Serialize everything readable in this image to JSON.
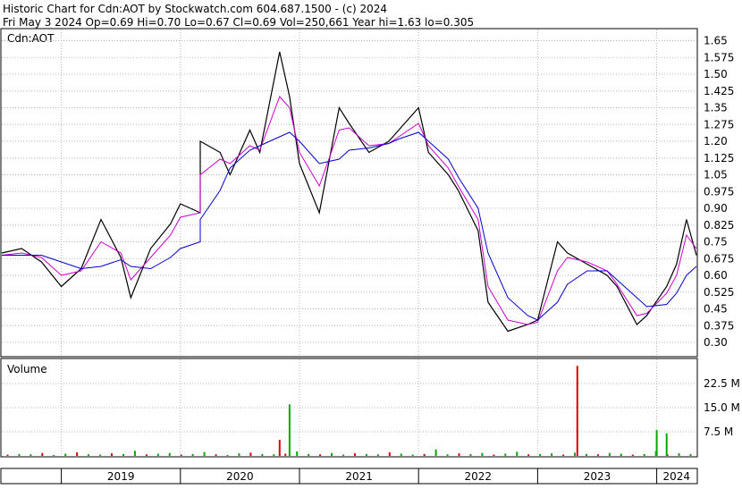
{
  "header": {
    "line1": "Historic Chart for Cdn:AOT by Stockwatch.com 604.687.1500 - (c) 2024",
    "line2": "Fri May  3 2024  Op=0.69  Hi=0.70  Lo=0.67  Cl=0.69  Vol=250,661  Year hi=1.63  lo=0.305"
  },
  "chart_data": [
    {
      "type": "line",
      "panel": "price",
      "title": "Cdn:AOT",
      "ylim": [
        0.24,
        1.7
      ],
      "y_ticks": [
        "1.65",
        "1.575",
        "1.50",
        "1.425",
        "1.35",
        "1.275",
        "1.20",
        "1.125",
        "1.05",
        "0.975",
        "0.90",
        "0.825",
        "0.75",
        "0.675",
        "0.60",
        "0.525",
        "0.45",
        "0.375",
        "0.30"
      ],
      "x_ticks": [
        "2019",
        "2020",
        "2021",
        "2022",
        "2023",
        "2024"
      ],
      "xlim": [
        "2018-07",
        "2024-05"
      ],
      "colors": {
        "price": "#000000",
        "ma_short": "#cc00cc",
        "ma_long": "#0000cc",
        "grid": "#b8b8b8"
      },
      "x": [
        "2018-07",
        "2018-09",
        "2018-11",
        "2019-01",
        "2019-03",
        "2019-05",
        "2019-07",
        "2019-08",
        "2019-10",
        "2019-12",
        "2020-01",
        "2020-03",
        "2020-03",
        "2020-05",
        "2020-06",
        "2020-08",
        "2020-09",
        "2020-11",
        "2020-12",
        "2021-01",
        "2021-03",
        "2021-05",
        "2021-06",
        "2021-08",
        "2021-10",
        "2021-11",
        "2022-01",
        "2022-02",
        "2022-04",
        "2022-05",
        "2022-07",
        "2022-08",
        "2022-10",
        "2022-12",
        "2023-01",
        "2023-03",
        "2023-04",
        "2023-06",
        "2023-08",
        "2023-09",
        "2023-11",
        "2023-12",
        "2024-02",
        "2024-03",
        "2024-04",
        "2024-05"
      ],
      "series": [
        {
          "values": [
            0.7,
            0.72,
            0.66,
            0.55,
            0.63,
            0.85,
            0.68,
            0.5,
            0.72,
            0.83,
            0.92,
            0.88,
            1.2,
            1.15,
            1.05,
            1.25,
            1.15,
            1.6,
            1.4,
            1.1,
            0.88,
            1.35,
            1.28,
            1.15,
            1.2,
            1.25,
            1.35,
            1.15,
            1.05,
            0.98,
            0.8,
            0.48,
            0.35,
            0.38,
            0.4,
            0.75,
            0.7,
            0.65,
            0.6,
            0.55,
            0.38,
            0.42,
            0.55,
            0.65,
            0.85,
            0.69
          ]
        },
        {
          "values": [
            0.69,
            0.7,
            0.68,
            0.6,
            0.62,
            0.75,
            0.7,
            0.58,
            0.68,
            0.78,
            0.86,
            0.88,
            1.05,
            1.12,
            1.1,
            1.18,
            1.16,
            1.4,
            1.35,
            1.15,
            1.0,
            1.25,
            1.26,
            1.18,
            1.19,
            1.22,
            1.28,
            1.18,
            1.08,
            1.0,
            0.85,
            0.55,
            0.4,
            0.38,
            0.39,
            0.62,
            0.68,
            0.66,
            0.62,
            0.56,
            0.42,
            0.43,
            0.52,
            0.6,
            0.78,
            0.72
          ]
        },
        {
          "values": [
            0.69,
            0.69,
            0.69,
            0.66,
            0.63,
            0.64,
            0.67,
            0.64,
            0.63,
            0.68,
            0.72,
            0.75,
            0.85,
            0.98,
            1.08,
            1.16,
            1.18,
            1.22,
            1.24,
            1.2,
            1.1,
            1.12,
            1.16,
            1.17,
            1.19,
            1.21,
            1.24,
            1.2,
            1.12,
            1.04,
            0.9,
            0.7,
            0.5,
            0.42,
            0.4,
            0.48,
            0.56,
            0.62,
            0.62,
            0.58,
            0.5,
            0.46,
            0.47,
            0.52,
            0.6,
            0.64
          ]
        }
      ]
    },
    {
      "type": "bar",
      "panel": "volume",
      "ylabel": "Volume",
      "ylim": [
        0,
        30
      ],
      "y_ticks": [
        "22.5 M",
        "15.0 M",
        "7.5 M"
      ],
      "x_ticks": [
        "2019",
        "2020",
        "2021",
        "2022",
        "2023",
        "2024"
      ],
      "xlim": [
        "2018-07",
        "2024-05"
      ],
      "colors": {
        "up": "#00aa00",
        "down": "#dd0000"
      },
      "spikes": [
        {
          "date": "2020-12",
          "value": 16.0,
          "dir": "up"
        },
        {
          "date": "2020-11",
          "value": 5.0,
          "dir": "down"
        },
        {
          "date": "2023-05",
          "value": 28.0,
          "dir": "down"
        },
        {
          "date": "2024-01",
          "value": 8.0,
          "dir": "up"
        },
        {
          "date": "2024-02",
          "value": 7.0,
          "dir": "up"
        }
      ],
      "baseline_values": [
        0.4,
        0.6,
        0.5,
        0.9,
        0.3,
        0.7,
        1.1,
        0.5,
        0.4,
        0.8,
        0.6,
        1.6,
        0.5,
        0.7,
        0.9,
        0.4,
        0.6,
        1.2,
        0.5,
        0.3,
        0.8,
        1.0,
        0.6,
        0.5,
        0.7,
        1.4,
        0.6,
        0.5,
        0.9,
        0.4,
        0.8,
        0.6,
        0.5,
        1.1,
        0.7,
        0.4,
        0.6,
        2.0,
        0.5,
        0.8,
        0.6,
        0.9,
        0.4,
        0.7,
        1.3,
        0.5,
        0.6,
        0.8,
        0.4,
        1.0,
        0.6,
        0.5,
        0.9,
        0.7,
        0.4,
        0.6,
        1.5,
        0.5,
        0.8,
        0.6
      ]
    }
  ]
}
